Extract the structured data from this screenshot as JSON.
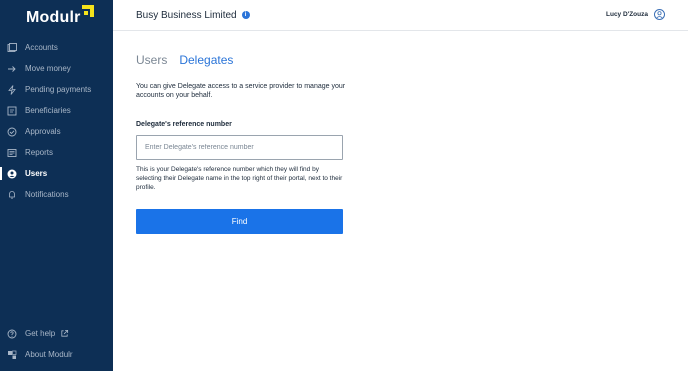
{
  "brand": {
    "name": "Modulr",
    "accent": "#f4e31c",
    "sidebar_bg": "#0d2f55"
  },
  "header": {
    "company": "Busy Business Limited",
    "user_name": "Lucy D'Zouza"
  },
  "sidebar": {
    "items": [
      {
        "label": "Accounts",
        "icon": "accounts-icon"
      },
      {
        "label": "Move money",
        "icon": "arrow-right-icon"
      },
      {
        "label": "Pending payments",
        "icon": "lightning-icon"
      },
      {
        "label": "Beneficiaries",
        "icon": "beneficiaries-icon"
      },
      {
        "label": "Approvals",
        "icon": "check-circle-icon"
      },
      {
        "label": "Reports",
        "icon": "reports-icon"
      },
      {
        "label": "Users",
        "icon": "users-icon",
        "active": true
      },
      {
        "label": "Notifications",
        "icon": "bell-icon"
      }
    ],
    "bottom": [
      {
        "label": "Get help",
        "icon": "help-icon",
        "external_icon": "external-link-icon"
      },
      {
        "label": "About Modulr",
        "icon": "info-icon"
      }
    ]
  },
  "tabs": [
    {
      "label": "Users",
      "active": false
    },
    {
      "label": "Delegates",
      "active": true
    }
  ],
  "delegates": {
    "intro": "You can give Delegate access to a service provider to manage your accounts on your behalf.",
    "field_label": "Delegate's reference number",
    "input_placeholder": "Enter Delegate's reference number",
    "input_value": "",
    "help_text": "This is your Delegate's reference number which they will  find by selecting their Delegate name in the top right of their portal, next to their profile.",
    "button_label": "Find",
    "button_color": "#1a73e8"
  }
}
